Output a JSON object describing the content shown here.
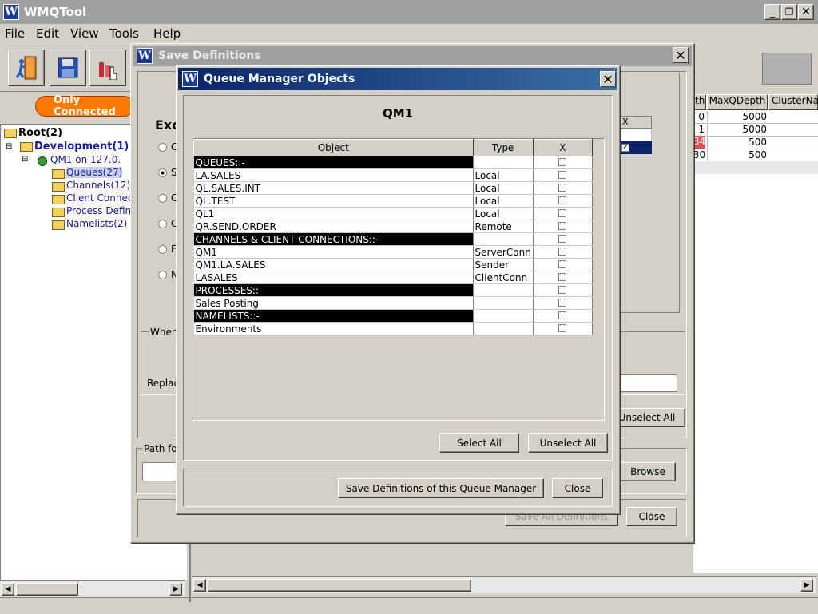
{
  "app": {
    "title": "WMQTool",
    "menu": [
      "File",
      "Edit",
      "View",
      "Tools",
      "Help"
    ]
  },
  "toolbar": {
    "connected_filter": "Only Connected"
  },
  "tree": {
    "root": "Root(2)",
    "group": "Development(1)",
    "qmgr": "QM1  on 127.0.",
    "items": [
      "Queues(27)",
      "Channels(12)",
      "Client Connect",
      "Process Defin",
      "Namelists(2)"
    ]
  },
  "right_table": {
    "headers": [
      "th",
      "MaxQDepth",
      "ClusterNa"
    ],
    "rows": [
      {
        "depth": "0",
        "max": "5000"
      },
      {
        "depth": "1",
        "max": "5000"
      },
      {
        "depth": "34",
        "max": "500"
      },
      {
        "depth": "30",
        "max": "500"
      }
    ]
  },
  "save_dialog": {
    "title": "Save Definitions",
    "section_label": "Exc",
    "radio_labels": [
      "C",
      "S",
      "C",
      "C",
      "F",
      "N"
    ],
    "when_label": "When",
    "replace_label": "Replac",
    "path_label": "Path fo",
    "x_header": "X",
    "unselect_all": "Unselect All",
    "browse": "Browse",
    "save_all": "Save All Definitions",
    "close": "Close"
  },
  "qm_dialog": {
    "title": "Queue Manager Objects",
    "qm_name": "QM1",
    "columns": [
      "Object",
      "Type",
      "X"
    ],
    "rows": [
      {
        "object": "QUEUES::-",
        "type": "",
        "category": true
      },
      {
        "object": "LA.SALES",
        "type": "Local",
        "category": false
      },
      {
        "object": "QL.SALES.INT",
        "type": "Local",
        "category": false
      },
      {
        "object": "QL.TEST",
        "type": "Local",
        "category": false
      },
      {
        "object": "QL1",
        "type": "Local",
        "category": false
      },
      {
        "object": "QR.SEND.ORDER",
        "type": "Remote",
        "category": false
      },
      {
        "object": "CHANNELS & CLIENT CONNECTIONS::-",
        "type": "",
        "category": true
      },
      {
        "object": "QM1",
        "type": "ServerConn",
        "category": false
      },
      {
        "object": "QM1.LA.SALES",
        "type": "Sender",
        "category": false
      },
      {
        "object": "LASALES",
        "type": "ClientConn",
        "category": false
      },
      {
        "object": "PROCESSES::-",
        "type": "",
        "category": true
      },
      {
        "object": "Sales  Posting",
        "type": "",
        "category": false
      },
      {
        "object": "NAMELISTS::-",
        "type": "",
        "category": true
      },
      {
        "object": "Environments",
        "type": "",
        "category": false
      }
    ],
    "select_all": "Select All",
    "unselect_all": "Unselect All",
    "save_qm": "Save Definitions of this Queue Manager",
    "close": "Close"
  },
  "colors": {
    "title_active": "#0a246a",
    "title_inactive": "#808080",
    "filter_orange": "#ff7a00",
    "category_black": "#000000",
    "highlight_red": "#e05050"
  }
}
